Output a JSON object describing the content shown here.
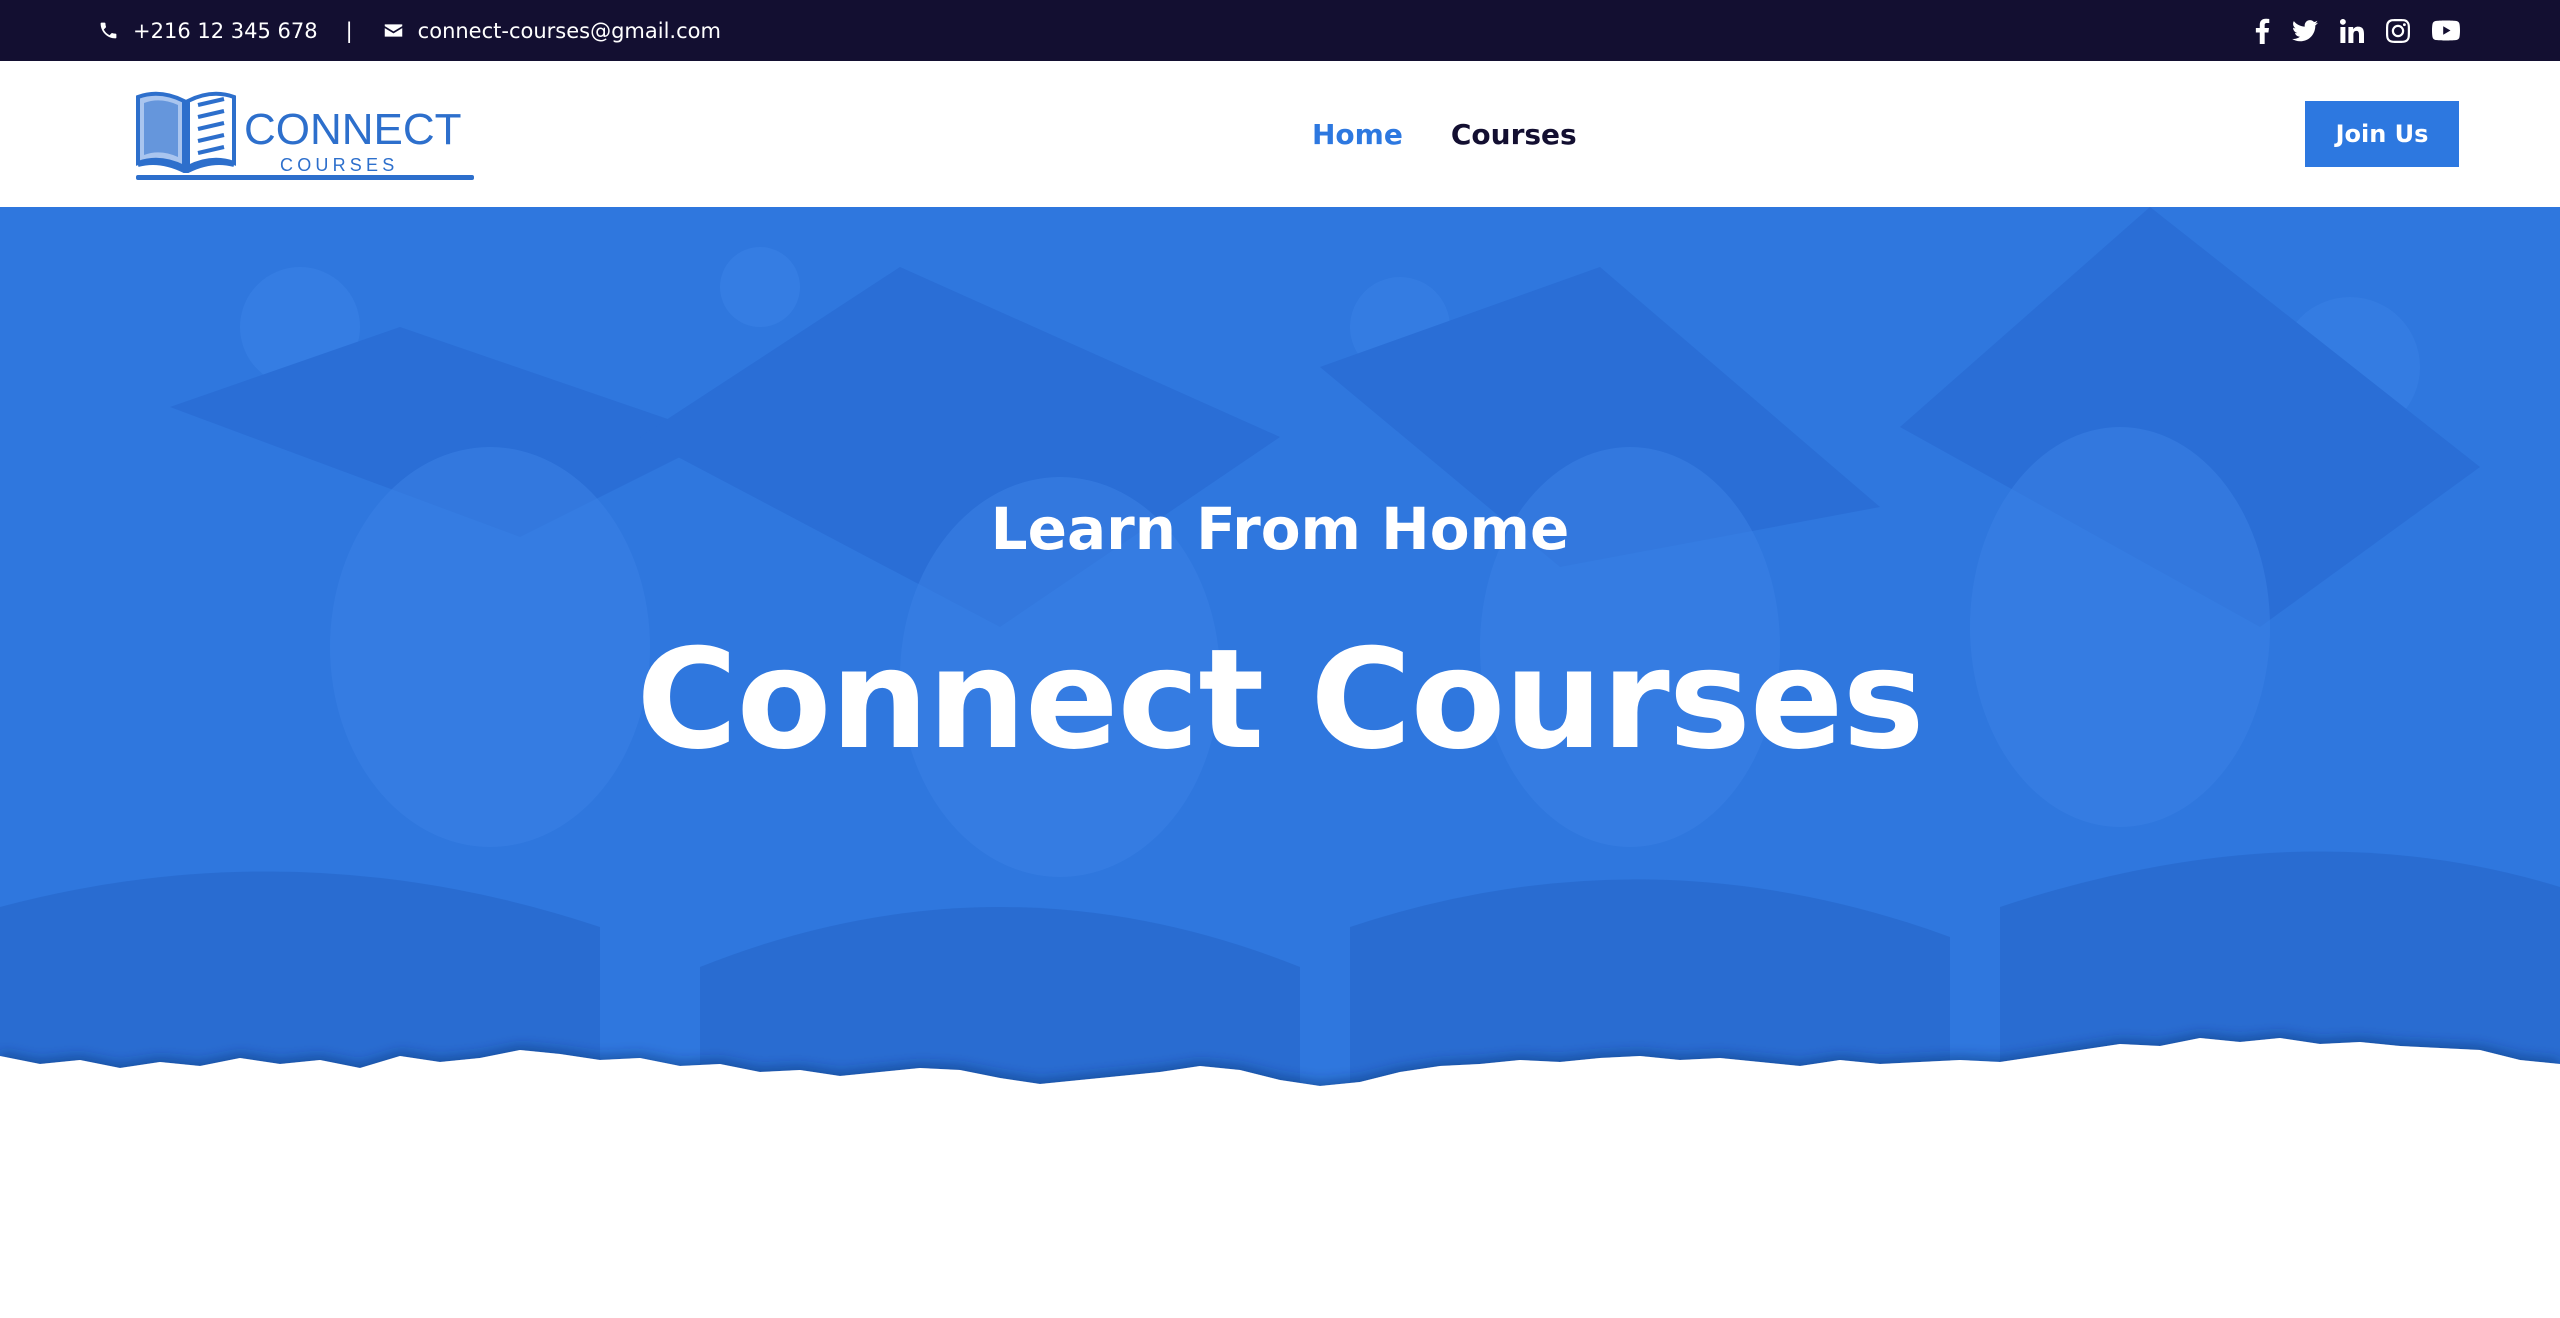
{
  "topbar": {
    "phone": "+216 12 345 678",
    "separator": "|",
    "email": "connect-courses@gmail.com",
    "phone_icon": "phone-icon",
    "email_icon": "envelope-icon",
    "socials": [
      "facebook-icon",
      "twitter-icon",
      "linkedin-icon",
      "instagram-icon",
      "youtube-icon"
    ]
  },
  "header": {
    "logo_main": "CONNECT",
    "logo_sub": "COURSES",
    "nav": {
      "home": "Home",
      "courses": "Courses"
    },
    "join_label": "Join Us"
  },
  "hero": {
    "subtitle": "Learn From Home",
    "title": "Connect Courses"
  },
  "colors": {
    "topbar_bg": "#130f31",
    "accent": "#2d78e0",
    "hero_overlay": "#2f77de",
    "nav_text": "#130f31",
    "white": "#ffffff"
  }
}
